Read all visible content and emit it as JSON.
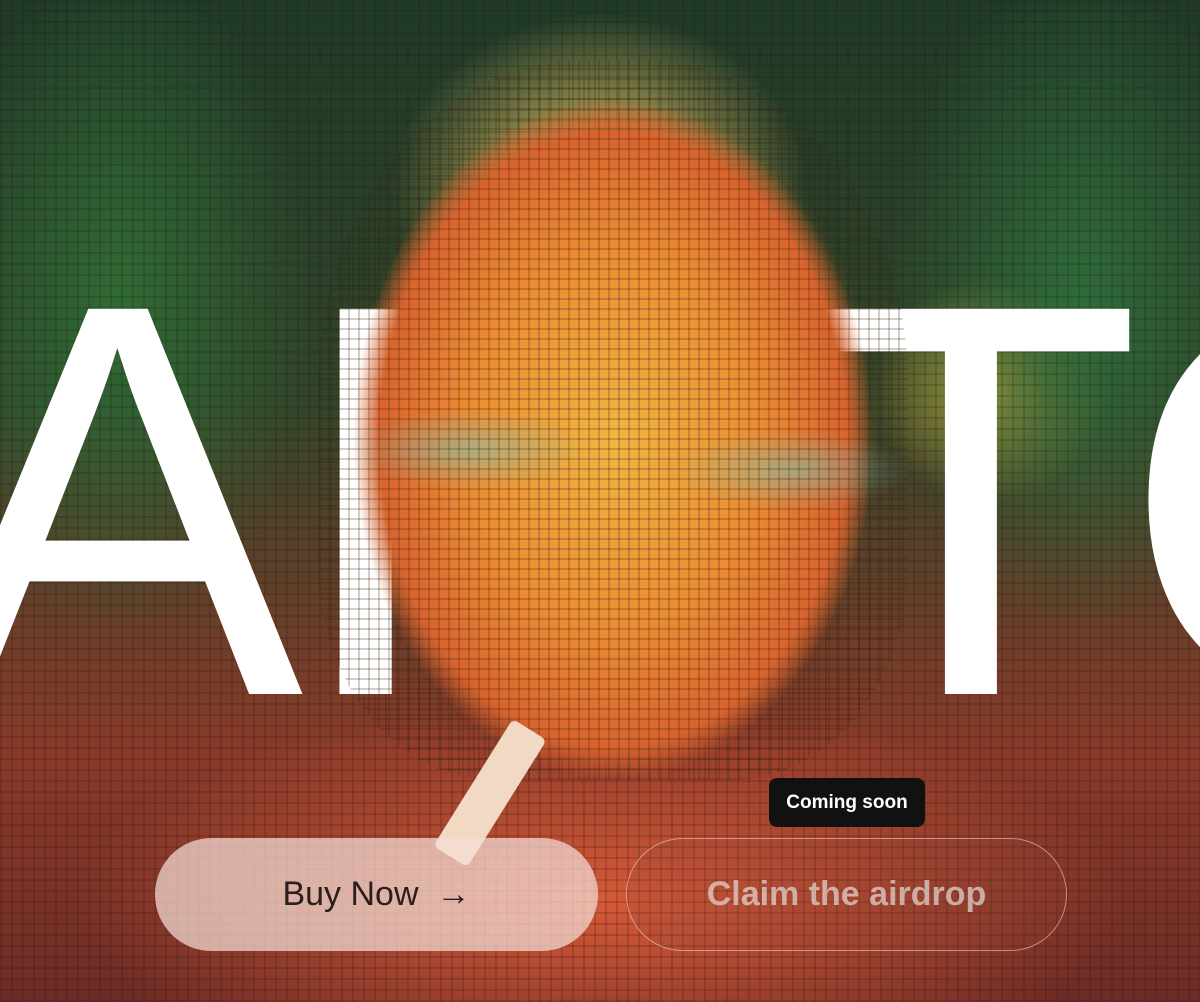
{
  "hero": {
    "title_left": "AP",
    "title_right": "TO"
  },
  "tooltip": {
    "text": "Coming soon"
  },
  "buttons": {
    "buy_label": "Buy Now",
    "buy_arrow": "→",
    "claim_label": "Claim the airdrop"
  },
  "colors": {
    "tooltip_bg": "#111111",
    "buy_button_bg": "#F4DCD6",
    "text_dark": "#2A1F1C",
    "title_white": "#FFFFFF"
  },
  "icons": {
    "buy_arrow": "arrow-right-icon"
  }
}
